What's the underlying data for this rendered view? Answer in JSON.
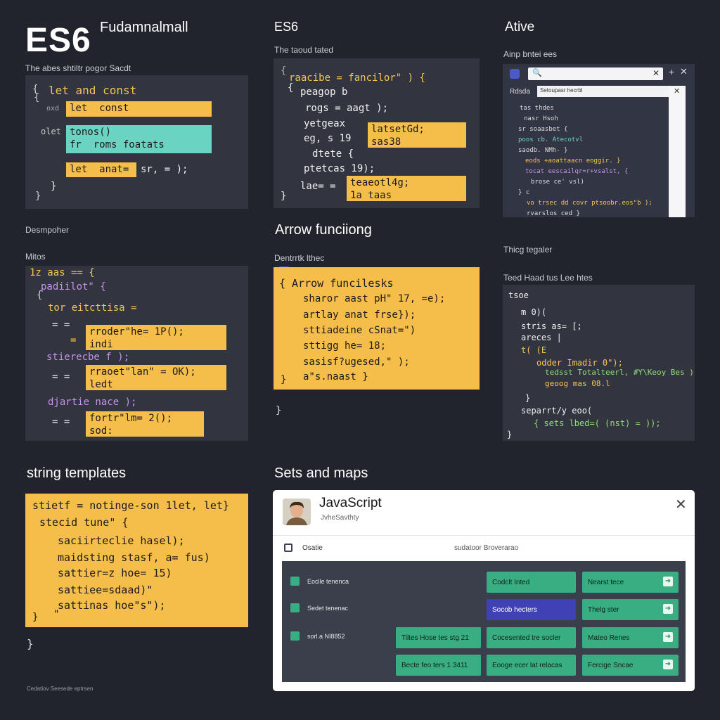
{
  "logo": "ES6",
  "title_main": "Fudamnalmall",
  "subtitle": "The abes shtiltr pogor Sacdt",
  "panel1": {
    "line1": "let and const",
    "hl1": "let  const",
    "hl2": "tonos()\nfr  roms foatats",
    "hl3": "let  anat=",
    "line3_tail": "sr,  = );",
    "left1": "oxd",
    "left2": "olet"
  },
  "col2": {
    "title": "ES6",
    "caption": "The taoud tated",
    "l1": "raacibe = fancilor\" ) {",
    "l2": "peagop b",
    "l3": "rogs  =  aagt  );",
    "l4": "yetgeax",
    "l5": "eg,  s  19",
    "l6": "dtete  {",
    "l7": "ptetcas  19);",
    "l8": "lae=",
    "hl1": "latsetGd;\nsas38",
    "hl2": "teaeotl4g;\n1a taas"
  },
  "col3": {
    "title": "Ative",
    "caption": "Ainp bntei ees",
    "dialog_field": "Setoupasr hecrbl",
    "sidebar_label": "Rdsda",
    "lines": [
      "tas  thdes",
      "nasr  Hsoh",
      "sr  soaasbet  {",
      "poos  cb.  Atecotvl",
      "saodb.  NMh-  }",
      "eods  +aoattaacn  eoggir.  }",
      "tocat  eescailqr=r+vsalst, {",
      "brose  ce'  vsl)",
      "} c",
      "vo  trsec  dd  covr  ptsoobr.eos\"b );",
      "rvarslos  ced  }"
    ]
  },
  "row2": {
    "left_caption1": "Desmpoher",
    "left_caption2": "Mitos",
    "mid_title": "Arrow funciiong",
    "mid_caption": "Dentrrtk lthec",
    "right_caption1": "Thicg tegaler",
    "right_caption2": "Teed Haad tus Lee htes"
  },
  "panel4": {
    "l1": "1z  aas  ==  {",
    "l2": "padiilot\"  {",
    "l3": "tor  eitcttisa  =",
    "l4": "=  =",
    "l5": "=",
    "l6": "stierecbe  f  );",
    "l7": "=  =",
    "l8": "djartie  nace  );",
    "l9": "=  =",
    "hl1": "rroder\"he= 1P();\nindi",
    "hl2": "rraoet\"lan\" = OK);\nledt",
    "hl3": "fortr\"lm= 2();\nsod:"
  },
  "panel5": {
    "l1": "{ Arrow funcilesks",
    "l2": "sharor  aast  pH\" 17,  =e);",
    "l3": "artlay  anat  frse});",
    "l4": "sttiadeine  cSnat=\")",
    "l5": "sttigg  he= 18;",
    "l6": "sasisf?ugesed,\" );",
    "l7": "a\"s.naast  }",
    "brace": "}",
    "after": "}"
  },
  "panel6": {
    "l1": "tsoe",
    "l2": "m 0)(",
    "l3": "stris  as=  [;",
    "l4": "areces  |",
    "l5": "t(  (E",
    "l6": "odder  Imadir  0\");",
    "l7": "tedsst  Totalteerl,  #Y\\Keoy  Bes );",
    "l8": "geoog  mas  08.l",
    "l9": "}",
    "l10": "separrt/y  eoo(",
    "l11": "{  sets  lbed=(  (nst)  =  ));",
    "l12": "}"
  },
  "string_templates": {
    "title": "string templates",
    "l1": "stietf = notinge-son 1let, let}",
    "l2": "stecid  tune\"  {",
    "l3": "saciirteclie  hasel);",
    "l4": "maidsting  stasf,  a=  fus)",
    "l5": "sattier=z  hoe=  15)",
    "l6": "sattiee=sdaad)\"",
    "l7": "sattinas  hoe\"s\");",
    "close1": "}",
    "close2": "\"",
    "after": "}"
  },
  "sets_maps": {
    "title": "Sets and maps",
    "window_title": "JavaScript",
    "window_sub": "JvheSavthty",
    "toolbar_label": "Osatie",
    "toolbar_center": "sudatoor Broverarao",
    "rows": [
      {
        "label": "Eoclle tenenca"
      },
      {
        "label": "Sedet tenenac"
      },
      {
        "label": "sorl.a  NI8852"
      }
    ],
    "buttons": [
      {
        "text": "Codclt          Inted"
      },
      {
        "text": "Nearst tece"
      },
      {
        "text": "Socob               hecters"
      },
      {
        "text": "Thelg ster"
      },
      {
        "text": "Tiltes Hose  tes stg  21"
      },
      {
        "text": "Cocesented  tre socler"
      },
      {
        "text": "Mateo Renes"
      },
      {
        "text": "Becte feo  ters  1  3411"
      },
      {
        "text": "Eooge ecer  lat  relacas"
      },
      {
        "text": "Fercige Sncae"
      }
    ],
    "arrow_glyph": "➜"
  },
  "footer": "Cedatiov  Seesede  eptrsen"
}
